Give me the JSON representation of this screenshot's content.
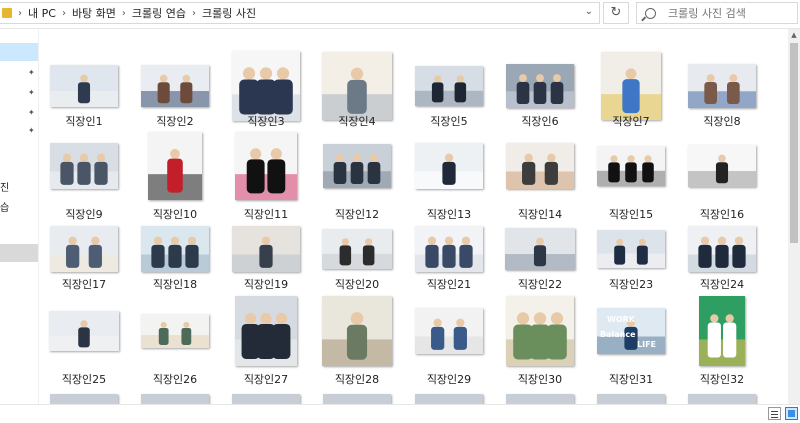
{
  "address_bar": {
    "breadcrumbs": [
      "내 PC",
      "바탕 화면",
      "크롤링 연습",
      "크롤링 사진"
    ],
    "refresh_icon": "refresh-icon",
    "dropdown_icon": "chevron-down-icon"
  },
  "search": {
    "placeholder": "크롤링 사진 검색"
  },
  "nav": {
    "partial_labels": [
      "진",
      "습"
    ]
  },
  "files": [
    {
      "name": "직장인1"
    },
    {
      "name": "직장인2"
    },
    {
      "name": "직장인3"
    },
    {
      "name": "직장인4"
    },
    {
      "name": "직장인5"
    },
    {
      "name": "직장인6"
    },
    {
      "name": "직장인7"
    },
    {
      "name": "직장인8"
    },
    {
      "name": "직장인9"
    },
    {
      "name": "직장인10"
    },
    {
      "name": "직장인11"
    },
    {
      "name": "직장인12"
    },
    {
      "name": "직장인13"
    },
    {
      "name": "직장인14"
    },
    {
      "name": "직장인15"
    },
    {
      "name": "직장인16"
    },
    {
      "name": "직장인17"
    },
    {
      "name": "직장인18"
    },
    {
      "name": "직장인19"
    },
    {
      "name": "직장인20"
    },
    {
      "name": "직장인21"
    },
    {
      "name": "직장인22"
    },
    {
      "name": "직장인23"
    },
    {
      "name": "직장인24"
    },
    {
      "name": "직장인25"
    },
    {
      "name": "직장인26"
    },
    {
      "name": "직장인27"
    },
    {
      "name": "직장인28"
    },
    {
      "name": "직장인29"
    },
    {
      "name": "직장인30"
    },
    {
      "name": "직장인31"
    },
    {
      "name": "직장인32"
    }
  ],
  "thumb_texts": {
    "work": "WORK",
    "balance": "Balance",
    "life": "LIFE"
  },
  "colors": {
    "selection": "#cce8ff",
    "folder": "#e8b531",
    "accent": "#2a7bd3"
  }
}
